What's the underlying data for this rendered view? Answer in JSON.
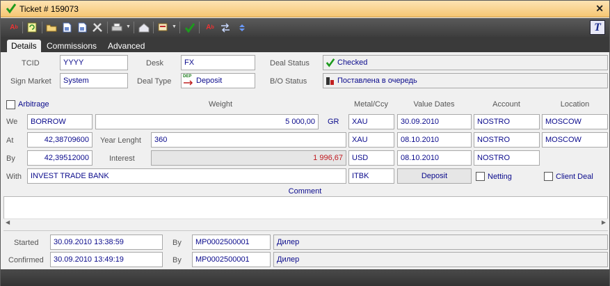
{
  "window": {
    "title": "Ticket # 159073",
    "close_symbol": "✕"
  },
  "toolbar": {
    "logo_letter": "T"
  },
  "tabs": [
    {
      "label": "Details"
    },
    {
      "label": "Commissions"
    },
    {
      "label": "Advanced"
    }
  ],
  "header_section": {
    "tcid_label": "TCID",
    "tcid_value": "YYYY",
    "desk_label": "Desk",
    "desk_value": "FX",
    "deal_status_label": "Deal Status",
    "deal_status_value": "Checked",
    "sign_market_label": "Sign Market",
    "sign_market_value": "System",
    "deal_type_label": "Deal Type",
    "deal_type_icon_text": "DEP",
    "deal_type_value": "Deposit",
    "bo_status_label": "B/O Status",
    "bo_status_value": "Поставлена в очередь"
  },
  "grid": {
    "arbitrage_label": "Arbitrage",
    "col_weight": "Weight",
    "col_metal": "Metal/Ccy",
    "col_value_dates": "Value Dates",
    "col_account": "Account",
    "col_location": "Location",
    "we_label": "We",
    "we_value": "BORROW",
    "weight_value": "5 000,00",
    "weight_unit": "GR",
    "we_metal": "XAU",
    "we_date": "30.09.2010",
    "we_account": "NOSTRO",
    "we_location": "MOSCOW",
    "at_label": "At",
    "at_value": "42,38709600",
    "year_length_label": "Year Lenght",
    "year_length_value": "360",
    "at_metal": "XAU",
    "at_date": "08.10.2010",
    "at_account": "NOSTRO",
    "at_location": "MOSCOW",
    "by_label": "By",
    "by_value": "42,39512000",
    "interest_label": "Interest",
    "interest_value": "1 996,67",
    "by_ccy": "USD",
    "by_date": "08.10.2010",
    "by_account": "NOSTRO",
    "with_label": "With",
    "with_value": "INVEST TRADE BANK",
    "with_code": "ITBK",
    "with_type": "Deposit",
    "netting_label": "Netting",
    "client_deal_label": "Client Deal"
  },
  "comment": {
    "label": "Comment",
    "value": ""
  },
  "audit": {
    "started_label": "Started",
    "started_time": "30.09.2010 13:38:59",
    "started_by_label": "By",
    "started_by_id": "MP0002500001",
    "started_by_role": "Дилер",
    "confirmed_label": "Confirmed",
    "confirmed_time": "30.09.2010 13:49:19",
    "confirmed_by_label": "By",
    "confirmed_by_id": "MP0002500001",
    "confirmed_by_role": "Дилер"
  },
  "colors": {
    "title_gradient": "#f6c673",
    "value_text": "#0a0a8c",
    "interest_text": "#c0181e",
    "toolbar_bg": "#4a4a4a"
  },
  "icons": {
    "title": "checkmark-icon",
    "toolbar": [
      "ab-icon",
      "refresh-icon",
      "open-folder-icon",
      "document-icon",
      "document-icon",
      "tools-icon",
      "print-icon",
      "home-icon",
      "copy-icon",
      "checkmark-icon",
      "ab-icon",
      "arrows-icon",
      "swap-icon"
    ]
  }
}
